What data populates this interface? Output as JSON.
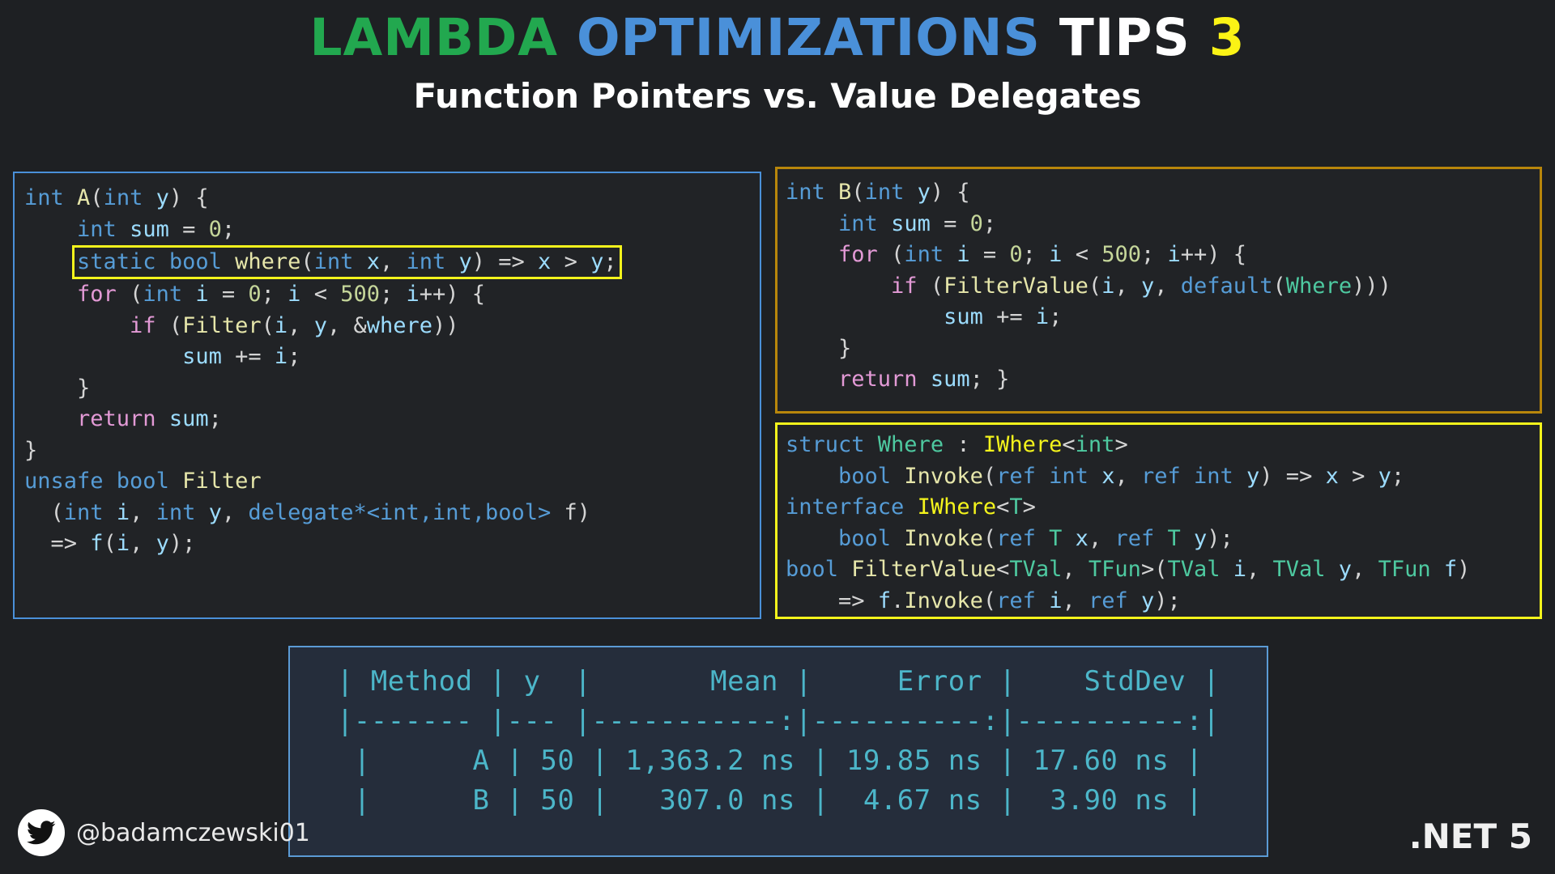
{
  "header": {
    "title_lambda": "LAMBDA",
    "title_optimizations": "OPTIMIZATIONS",
    "title_tips": "TIPS",
    "title_number": "3",
    "subtitle": "Function Pointers vs. Value Delegates",
    "colors": {
      "lambda": "#22a84f",
      "optimizations": "#4a90d9",
      "tips": "#ffffff",
      "number": "#fbf315"
    }
  },
  "code_left": {
    "border_color": "#4a90d9",
    "l1_a": "int ",
    "l1_b": "A",
    "l1_c": "(",
    "l1_d": "int ",
    "l1_e": "y",
    "l1_f": ") {",
    "l2_a": "int ",
    "l2_b": "sum ",
    "l2_c": "= ",
    "l2_d": "0",
    "l2_e": ";",
    "hl_a": "static ",
    "hl_b": "bool ",
    "hl_c": "where",
    "hl_d": "(",
    "hl_e": "int ",
    "hl_f": "x",
    "hl_g": ", ",
    "hl_h": "int ",
    "hl_i": "y",
    "hl_j": ") => ",
    "hl_k": "x",
    "hl_l": " > ",
    "hl_m": "y",
    "hl_n": ";",
    "l4_a": "for ",
    "l4_b": "(",
    "l4_c": "int ",
    "l4_d": "i ",
    "l4_e": "= ",
    "l4_f": "0",
    "l4_g": "; ",
    "l4_h": "i ",
    "l4_i": "< ",
    "l4_j": "500",
    "l4_k": "; ",
    "l4_l": "i",
    "l4_m": "++) {",
    "l5_a": "if ",
    "l5_b": "(",
    "l5_c": "Filter",
    "l5_d": "(",
    "l5_e": "i",
    "l5_f": ", ",
    "l5_g": "y",
    "l5_h": ", &",
    "l5_i": "where",
    "l5_j": "))",
    "l6_a": "sum ",
    "l6_b": "+= ",
    "l6_c": "i",
    "l6_d": ";",
    "l7": "}",
    "l8_a": "return ",
    "l8_b": "sum",
    "l8_c": ";",
    "l9": "}",
    "l10_a": "unsafe ",
    "l10_b": "bool ",
    "l10_c": "Filter",
    "l11_a": "(",
    "l11_b": "int ",
    "l11_c": "i",
    "l11_d": ", ",
    "l11_e": "int ",
    "l11_f": "y",
    "l11_g": ", ",
    "l11_h": "delegate*<int,int,bool>",
    "l11_i": " f)",
    "l12_a": "=> ",
    "l12_b": "f",
    "l12_c": "(",
    "l12_d": "i",
    "l12_e": ", ",
    "l12_f": "y",
    "l12_g": ");"
  },
  "code_right_a": {
    "border_color": "#b8860b",
    "l1_a": "int ",
    "l1_b": "B",
    "l1_c": "(",
    "l1_d": "int ",
    "l1_e": "y",
    "l1_f": ") {",
    "l2_a": "int ",
    "l2_b": "sum ",
    "l2_c": "= ",
    "l2_d": "0",
    "l2_e": ";",
    "l3_a": "for ",
    "l3_b": "(",
    "l3_c": "int ",
    "l3_d": "i ",
    "l3_e": "= ",
    "l3_f": "0",
    "l3_g": "; ",
    "l3_h": "i ",
    "l3_i": "< ",
    "l3_j": "500",
    "l3_k": "; ",
    "l3_l": "i",
    "l3_m": "++) {",
    "l4_a": "if ",
    "l4_b": "(",
    "l4_c": "FilterValue",
    "l4_d": "(",
    "l4_e": "i",
    "l4_f": ", ",
    "l4_g": "y",
    "l4_h": ", ",
    "l4_i": "default",
    "l4_j": "(",
    "l4_k": "Where",
    "l4_l": ")))",
    "l5_a": "sum ",
    "l5_b": "+= ",
    "l5_c": "i",
    "l5_d": ";",
    "l6": "}",
    "l7_a": "return ",
    "l7_b": "sum",
    "l7_c": "; }"
  },
  "code_right_b": {
    "border_color": "#f4f41c",
    "l1_a": "struct ",
    "l1_b": "Where",
    "l1_c": " : ",
    "l1_d": "IWhere",
    "l1_e": "<",
    "l1_f": "int",
    "l1_g": ">",
    "l2_a": "bool ",
    "l2_b": "Invoke",
    "l2_c": "(",
    "l2_d": "ref ",
    "l2_e": "int ",
    "l2_f": "x",
    "l2_g": ", ",
    "l2_h": "ref ",
    "l2_i": "int ",
    "l2_j": "y",
    "l2_k": ") => ",
    "l2_l": "x",
    "l2_m": " > ",
    "l2_n": "y",
    "l2_o": ";",
    "l3_a": "interface ",
    "l3_b": "IWhere",
    "l3_c": "<",
    "l3_d": "T",
    "l3_e": ">",
    "l4_a": "bool ",
    "l4_b": "Invoke",
    "l4_c": "(",
    "l4_d": "ref ",
    "l4_e": "T ",
    "l4_f": "x",
    "l4_g": ", ",
    "l4_h": "ref ",
    "l4_i": "T ",
    "l4_j": "y",
    "l4_k": ");",
    "l5_a": "bool ",
    "l5_b": "FilterValue",
    "l5_c": "<",
    "l5_d": "TVal",
    "l5_e": ", ",
    "l5_f": "TFun",
    "l5_g": ">(",
    "l5_h": "TVal ",
    "l5_i": "i",
    "l5_j": ", ",
    "l5_k": "TVal ",
    "l5_l": "y",
    "l5_m": ", ",
    "l5_n": "TFun ",
    "l5_o": "f",
    "l5_p": ")",
    "l6_a": "=> ",
    "l6_b": "f",
    "l6_c": ".",
    "l6_d": "Invoke",
    "l6_e": "(",
    "l6_f": "ref ",
    "l6_g": "i",
    "l6_h": ", ",
    "l6_i": "ref ",
    "l6_j": "y",
    "l6_k": ");"
  },
  "benchmark": {
    "border_color": "#5b9bd5",
    "text_color": "#4cb6c9",
    "columns": [
      "Method",
      "y",
      "Mean",
      "Error",
      "StdDev"
    ],
    "header_row": "| Method | y  |       Mean |     Error |    StdDev |",
    "separator_row": "|------- |--- |-----------:|----------:|----------:|",
    "rows": [
      "|      A | 50 | 1,363.2 ns | 19.85 ns | 17.60 ns |",
      "|      B | 50 |   307.0 ns |  4.67 ns |  3.90 ns |"
    ],
    "data": [
      {
        "method": "A",
        "y": "50",
        "mean": "1,363.2 ns",
        "error": "19.85 ns",
        "stddev": "17.60 ns"
      },
      {
        "method": "B",
        "y": "50",
        "mean": "307.0 ns",
        "error": "4.67 ns",
        "stddev": "3.90 ns"
      }
    ]
  },
  "footer": {
    "twitter_handle": "@badamczewski01",
    "platform": ".NET 5"
  }
}
